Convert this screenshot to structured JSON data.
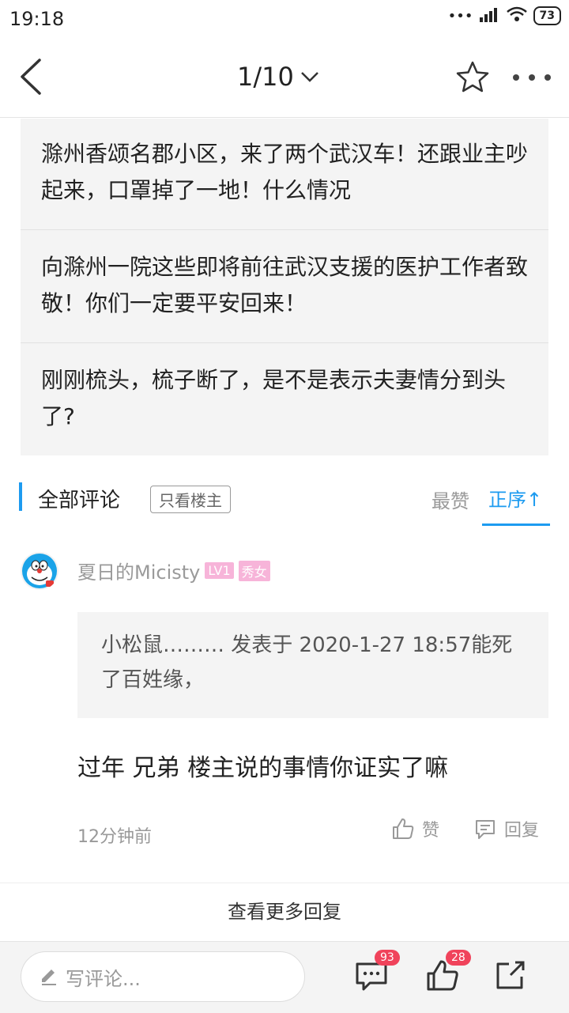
{
  "status": {
    "time": "19:18",
    "battery": "73",
    "network": "HD"
  },
  "topbar": {
    "page_indicator": "1/10"
  },
  "cards": [
    "滁州香颂名郡小区，来了两个武汉车！还跟业主吵起来，口罩掉了一地！什么情况",
    "向滁州一院这些即将前往武汉支援的医护工作者致敬！你们一定要平安回来！",
    "刚刚梳头，梳子断了，是不是表示夫妻情分到头了?"
  ],
  "comments_section": {
    "title": "全部评论",
    "only_host": "只看楼主",
    "sort_best": "最赞",
    "sort_order": "正序↑"
  },
  "comment": {
    "username": "夏日的Micisty",
    "level": "LV1",
    "tag": "秀女",
    "quote": "小松鼠……… 发表于 2020-1-27 18:57能死了百姓缘，",
    "text": "过年 兄弟 楼主说的事情你证实了嘛",
    "time": "12分钟前",
    "like_label": "赞",
    "reply_label": "回复"
  },
  "view_more": "查看更多回复",
  "bottom": {
    "input_placeholder": "写评论...",
    "comment_count": "93",
    "like_count": "28"
  },
  "colors": {
    "accent": "#1d9bf0",
    "badge": "#f0435b",
    "tag": "#f7b4d9"
  }
}
